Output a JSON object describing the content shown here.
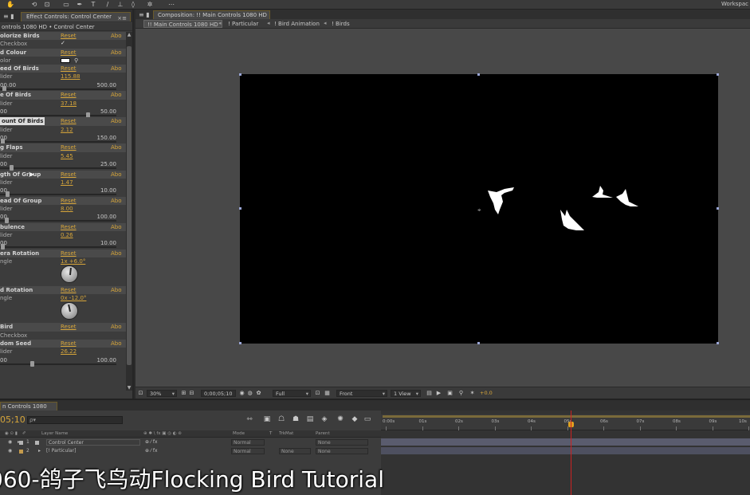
{
  "toolbar": {
    "workspace_label": "Workspac"
  },
  "effect_controls": {
    "tab_label": "Effect Controls: Control Center",
    "close_label": "×≡",
    "subtitle": "ontrols 1080 HD • Control Center",
    "reset_label": "Reset",
    "about_label": "Abo",
    "rows": [
      {
        "kind": "header",
        "name": "olorize Birds"
      },
      {
        "kind": "check",
        "label": "Checkbox",
        "checked": "✓"
      },
      {
        "kind": "header",
        "name": "d Colour"
      },
      {
        "kind": "color",
        "label": "olor",
        "swatch": "#ffffff"
      },
      {
        "kind": "header",
        "name": "eed Of Birds"
      },
      {
        "kind": "value",
        "label": "lider",
        "value": "115.88"
      },
      {
        "kind": "range",
        "min": "00.00",
        "max": "500.00",
        "knob": 0.02
      },
      {
        "kind": "header",
        "name": "e Of Birds"
      },
      {
        "kind": "value",
        "label": "lider",
        "value": "37.18"
      },
      {
        "kind": "range",
        "min": "00",
        "max": "50.00",
        "knob": 0.74
      },
      {
        "kind": "header",
        "name": "ount Of Birds",
        "selected": true
      },
      {
        "kind": "value",
        "label": "lider",
        "value": "2.12"
      },
      {
        "kind": "range",
        "min": "00",
        "max": "150.00",
        "knob": 0.01
      },
      {
        "kind": "header",
        "name": "g Flaps"
      },
      {
        "kind": "value",
        "label": "lider",
        "value": "5.45"
      },
      {
        "kind": "range",
        "min": "00",
        "max": "25.00",
        "knob": 0.08
      },
      {
        "kind": "header",
        "name": "gth Of Group"
      },
      {
        "kind": "value",
        "label": "lider",
        "value": "1.47"
      },
      {
        "kind": "range",
        "min": "00",
        "max": "10.00",
        "knob": 0.05
      },
      {
        "kind": "header",
        "name": "ead Of Group"
      },
      {
        "kind": "value",
        "label": "lider",
        "value": "8.00"
      },
      {
        "kind": "range",
        "min": "00",
        "max": "100.00",
        "knob": 0.04
      },
      {
        "kind": "header",
        "name": "bulence"
      },
      {
        "kind": "value",
        "label": "lider",
        "value": "0.26"
      },
      {
        "kind": "range",
        "min": "00",
        "max": "10.00",
        "knob": 0.01
      },
      {
        "kind": "header",
        "name": "era Rotation"
      },
      {
        "kind": "dial",
        "label": "ngle",
        "value": "1x +6.0°",
        "angle": 6
      },
      {
        "kind": "header",
        "name": "d Rotation"
      },
      {
        "kind": "dial",
        "label": "ngle",
        "value": "0x -12.0°",
        "angle": -12
      },
      {
        "kind": "header",
        "name": "Bird"
      },
      {
        "kind": "check",
        "label": "Checkbox",
        "checked": ""
      },
      {
        "kind": "header",
        "name": "dom Seed"
      },
      {
        "kind": "value",
        "label": "lider",
        "value": "26.22"
      },
      {
        "kind": "range",
        "min": "00",
        "max": "100.00",
        "knob": 0.26
      }
    ]
  },
  "composition": {
    "tab_label": "Composition: !! Main Controls 1080 HD",
    "crumbs": [
      "!! Main Controls 1080 HD",
      "! Particular",
      "! Bird Animation",
      "! Birds"
    ],
    "footer": {
      "zoom": "30%",
      "timecode": "0;00;05;10",
      "resolution": "Full",
      "view": "Front",
      "views": "1 View",
      "exposure": "+0.0"
    }
  },
  "timeline": {
    "tab_label": "n Controls 1080 HD",
    "timecode": "05;10",
    "search_placeholder": "ρ▾",
    "columns": {
      "layer_name": "Layer Name",
      "mode": "Mode",
      "t": "T",
      "trkmat": "TrkMat",
      "parent": "Parent"
    },
    "layers": [
      {
        "num": "1",
        "name": "Control Center",
        "mode": "Normal",
        "trkmat": "",
        "parent": "None",
        "color": "#b5b5b5"
      },
      {
        "num": "2",
        "name": "[! Particular]",
        "mode": "Normal",
        "trkmat": "None",
        "parent": "None",
        "color": "#c49a4c"
      }
    ],
    "ruler_labels": [
      "0:00s",
      "01s",
      "02s",
      "03s",
      "04s",
      "05s",
      "06s",
      "07s",
      "08s",
      "09s",
      "10s"
    ]
  },
  "caption": {
    "text": "060-鸽子飞鸟动Flocking Bird Tutorial"
  }
}
